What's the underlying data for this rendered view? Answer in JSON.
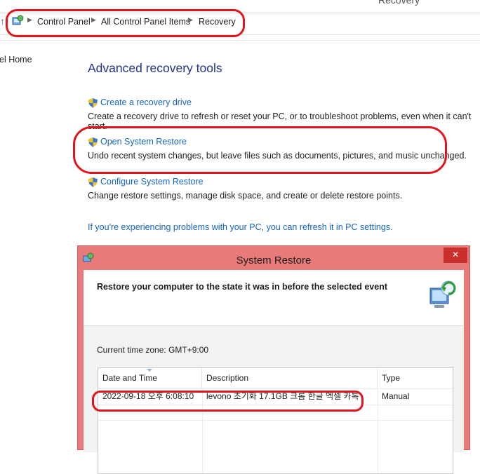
{
  "window": {
    "title": "Recovery"
  },
  "breadcrumb": {
    "items": [
      "Control Panel",
      "All Control Panel Items",
      "Recovery"
    ]
  },
  "nav": {
    "home_label": "el Home"
  },
  "main": {
    "heading": "Advanced recovery tools",
    "tools": [
      {
        "link": "Create a recovery drive",
        "description": "Create a recovery drive to refresh or reset your PC, or to troubleshoot problems, even when it can't start."
      },
      {
        "link": "Open System Restore",
        "description": "Undo recent system changes, but leave files such as documents, pictures, and music unchanged."
      },
      {
        "link": "Configure System Restore",
        "description": "Change restore settings, manage disk space, and create or delete restore points."
      }
    ],
    "refresh_link": "If you're experiencing problems with your PC, you can refresh it in PC settings."
  },
  "dialog": {
    "title": "System Restore",
    "close": "×",
    "header_text": "Restore your computer to the state it was in before the selected event",
    "timezone": "Current time zone: GMT+9:00",
    "columns": [
      "Date and Time",
      "Description",
      "Type"
    ],
    "rows": [
      {
        "date": "2022-09-18 오후 6:08:10",
        "description": "levono 초기화 17.1GB 크롬 한글 엑셀 카톡",
        "type": "Manual"
      }
    ]
  },
  "colors": {
    "annotation_red": "#e0141e",
    "link_blue": "#1565c0",
    "heading_blue": "#1e3287"
  }
}
